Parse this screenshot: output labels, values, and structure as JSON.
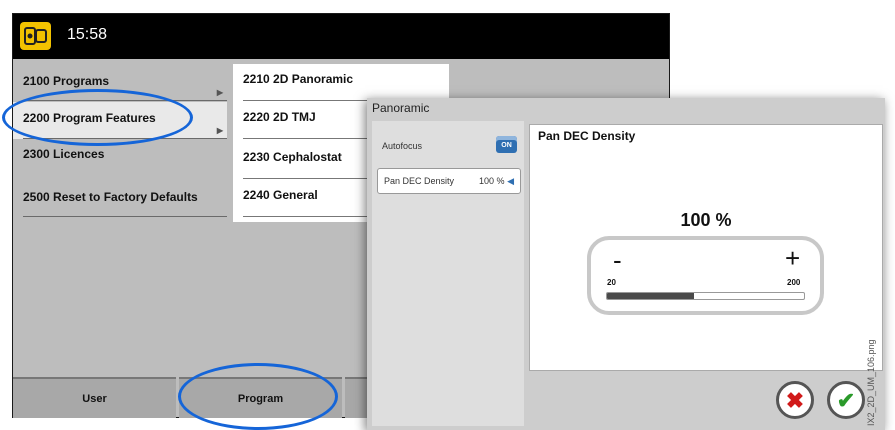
{
  "header": {
    "time": "15:58",
    "app_icon": "device-icon"
  },
  "menu": {
    "items": [
      {
        "label": "2100  Programs",
        "has_arrow": true
      },
      {
        "label": "2200  Program Features",
        "has_arrow": true
      },
      {
        "label": "2300  Licences",
        "has_arrow": false
      },
      {
        "label": "2500  Reset to Factory Defaults",
        "has_arrow": false
      }
    ],
    "selected_index": 1
  },
  "submenu": {
    "items": [
      {
        "label": "2210  2D Panoramic"
      },
      {
        "label": "2220  2D TMJ"
      },
      {
        "label": "2230  Cephalostat"
      },
      {
        "label": "2240  General"
      }
    ]
  },
  "tabs": [
    {
      "label": "User"
    },
    {
      "label": "Program"
    }
  ],
  "panel": {
    "title": "Panoramic",
    "autofocus_label": "Autofocus",
    "autofocus_toggle": "ON",
    "density_label": "Pan DEC Density",
    "density_value": "100 %",
    "detail_title": "Pan DEC Density",
    "detail_value": "100 %",
    "minus": "-",
    "plus": "+",
    "min": "20",
    "max": "200",
    "slider_fraction": 0.44,
    "cancel_icon": "cancel-x-icon",
    "confirm_icon": "confirm-check-icon"
  },
  "side_label": "IX2_2D_UM_106.png",
  "colors": {
    "annotation": "#1565d8",
    "toggle": "#2f6fb2",
    "cancel": "#d11a1a",
    "confirm": "#2a9a2a"
  }
}
